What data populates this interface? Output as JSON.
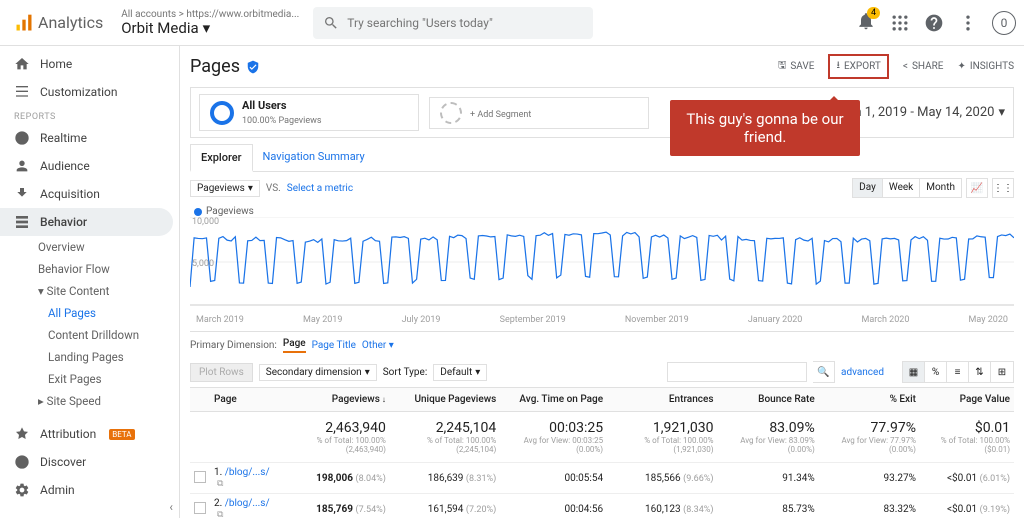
{
  "header": {
    "brand": "Analytics",
    "account_path": "All accounts > https://www.orbitmedia...",
    "property": "Orbit Media",
    "search_placeholder": "Try searching \"Users today\"",
    "bell_badge": "4",
    "avatar_letter": "0"
  },
  "sidebar": {
    "home": "Home",
    "customization": "Customization",
    "reports_label": "REPORTS",
    "realtime": "Realtime",
    "audience": "Audience",
    "acquisition": "Acquisition",
    "behavior": "Behavior",
    "behavior_subs": {
      "overview": "Overview",
      "flow": "Behavior Flow",
      "site_content": "Site Content",
      "all_pages": "All Pages",
      "content_drilldown": "Content Drilldown",
      "landing": "Landing Pages",
      "exit": "Exit Pages",
      "site_speed": "Site Speed"
    },
    "attribution": "Attribution",
    "beta": "BETA",
    "discover": "Discover",
    "admin": "Admin"
  },
  "page": {
    "title": "Pages",
    "save": "SAVE",
    "export": "EXPORT",
    "share": "SHARE",
    "insights": "INSIGHTS",
    "date_range": "Jan 1, 2019 - May 14, 2020"
  },
  "segments": {
    "all_users_label": "All Users",
    "all_users_sub": "100.00% Pageviews",
    "add": "+ Add Segment"
  },
  "callout": "This guy's gonna be our friend.",
  "tabs": {
    "explorer": "Explorer",
    "nav_summary": "Navigation Summary"
  },
  "chart_ctrl": {
    "metric": "Pageviews",
    "vs": "VS.",
    "select_metric": "Select a metric",
    "day": "Day",
    "week": "Week",
    "month": "Month"
  },
  "chart_data": {
    "type": "line",
    "series_name": "Pageviews",
    "ylim": [
      0,
      10000
    ],
    "yticks": [
      "10,000",
      "5,000"
    ],
    "xticks": [
      "March 2019",
      "May 2019",
      "July 2019",
      "September 2019",
      "November 2019",
      "January 2020",
      "March 2020",
      "May 2020"
    ],
    "note": "Daily pageviews oscillating roughly between ~2,000 (weekend troughs) and ~8,500 (weekday peaks) across Jan 2019 – May 2020"
  },
  "dims": {
    "label": "Primary Dimension:",
    "page": "Page",
    "page_title": "Page Title",
    "other": "Other"
  },
  "tbl_ctrl": {
    "plot_rows": "Plot Rows",
    "secondary": "Secondary dimension",
    "sort_type": "Sort Type:",
    "default": "Default",
    "advanced": "advanced"
  },
  "table": {
    "cols": {
      "page": "Page",
      "pageviews": "Pageviews",
      "unique": "Unique Pageviews",
      "avg_time": "Avg. Time on Page",
      "entrances": "Entrances",
      "bounce": "Bounce Rate",
      "exit": "% Exit",
      "value": "Page Value"
    },
    "totals": {
      "pageviews": "2,463,940",
      "pageviews_sub": "% of Total: 100.00% (2,463,940)",
      "unique": "2,245,104",
      "unique_sub": "% of Total: 100.00% (2,245,104)",
      "avg_time": "00:03:25",
      "avg_time_sub": "Avg for View: 00:03:25 (0.00%)",
      "entrances": "1,921,030",
      "entrances_sub": "% of Total: 100.00% (1,921,030)",
      "bounce": "83.09%",
      "bounce_sub": "Avg for View: 83.09% (0.00%)",
      "exit": "77.97%",
      "exit_sub": "Avg for View: 77.97% (0.00%)",
      "value": "$0.01",
      "value_sub": "% of Total: 100.00% ($0.01)"
    },
    "rows": [
      {
        "n": "1.",
        "page": "/blog/...s/",
        "pv": "198,006",
        "pv_pct": "(8.04%)",
        "u": "186,639",
        "u_pct": "(8.31%)",
        "t": "00:05:54",
        "e": "185,566",
        "e_pct": "(9.66%)",
        "b": "91.34%",
        "x": "93.27%",
        "v": "<$0.01",
        "v_pct": "(6.01%)"
      },
      {
        "n": "2.",
        "page": "/blog/...s/",
        "pv": "185,769",
        "pv_pct": "(7.54%)",
        "u": "161,594",
        "u_pct": "(7.20%)",
        "t": "00:04:56",
        "e": "160,123",
        "e_pct": "(8.34%)",
        "b": "85.73%",
        "x": "83.32%",
        "v": "<$0.01",
        "v_pct": "(9.19%)"
      }
    ]
  }
}
